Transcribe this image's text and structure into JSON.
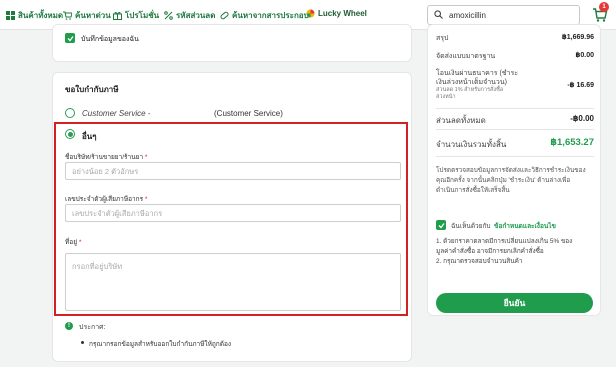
{
  "nav": {
    "items": [
      {
        "label": "สินค้าทั้งหมด",
        "icon": "grid-icon"
      },
      {
        "label": "ค้นหาด่วน",
        "icon": "cart-icon"
      },
      {
        "label": "โปรโมชั่น",
        "icon": "gift-icon"
      },
      {
        "label": "รหัสส่วนลด",
        "icon": "percent-icon"
      },
      {
        "label": "ค้นหาจากสารประกอบ",
        "icon": "pill-icon"
      },
      {
        "label": "Lucky Wheel",
        "icon": "wheel-icon"
      }
    ],
    "search_value": "amoxicillin",
    "cart_count": "1"
  },
  "save_info": {
    "label": "บันทึกข้อมูลของฉัน",
    "checked": true
  },
  "invoice": {
    "title": "ขอใบกำกับภาษี",
    "option1_a": "Customer Service -",
    "option1_b": "(Customer Service)",
    "option2": "อื่นๆ",
    "company_label": "ชื่อบริษัท/ร้านขายยา/ร้านยา",
    "company_placeholder": "อย่างน้อย 2 ตัวอักษร",
    "taxid_label": "เลขประจำตัวผู้เสียภาษีอากร",
    "taxid_placeholder": "เลขประจำตัวผู้เสียภาษีอากร",
    "address_label": "ที่อยู่",
    "address_placeholder": "กรอกที่อยู่บริษัท",
    "required_mark": "*",
    "note_title": "ประกาศ:",
    "note_text": "กรุณากรอกข้อมูลสำหรับออกใบกำกับภาษีให้ถูกต้อง"
  },
  "summary": {
    "subtotal_label": "สรุป",
    "subtotal_value": "฿1,669.96",
    "shipping_label": "จัดส่งแบบมาตรฐาน",
    "shipping_value": "฿0.00",
    "transfer_label_1": "โอนเงินผ่านธนาคาร (ชำระ",
    "transfer_label_2": "เงินล่วงหน้าเต็มจำนวน)",
    "transfer_sub_1": "ส่วนลด 1% สำหรับการสั่งซื้อ",
    "transfer_sub_2": "ล่วงหน้า",
    "transfer_value": "-฿ 16.69",
    "discount_label": "ส่วนลดทั้งหมด",
    "discount_value": "-฿0.00",
    "total_label": "จำนวนเงินรวมทั้งสิ้น",
    "total_value": "฿1,653.27",
    "review_1": "โปรดตรวจสอบข้อมูลการจัดส่งและวิธีการชำระเงินของ",
    "review_2": "คุณอีกครั้ง จากนั้นคลิกปุ่ม 'ชำระเงิน' ด้านล่างเพื่อ",
    "review_3": "ดำเนินการสั่งซื้อให้เสร็จสิ้น",
    "terms_prefix": "ฉันเห็นด้วยกับ",
    "terms_link": "ข้อกำหนดและเงื่อนไข",
    "cond_1a": "1. ด้วยกราคาตลาดมีการเปลี่ยนแปลงเกิน 5% ของ",
    "cond_1b": "มูลค่าคำสั่งซื้อ อาจมีการยกเลิกคำสั่งซื้อ",
    "cond_2": "2. กรุณาตรวจสอบจำนวนสินค้า",
    "confirm_label": "ยืนยัน"
  },
  "colors": {
    "accent": "#1f9d4d",
    "highlight": "#d32020"
  }
}
